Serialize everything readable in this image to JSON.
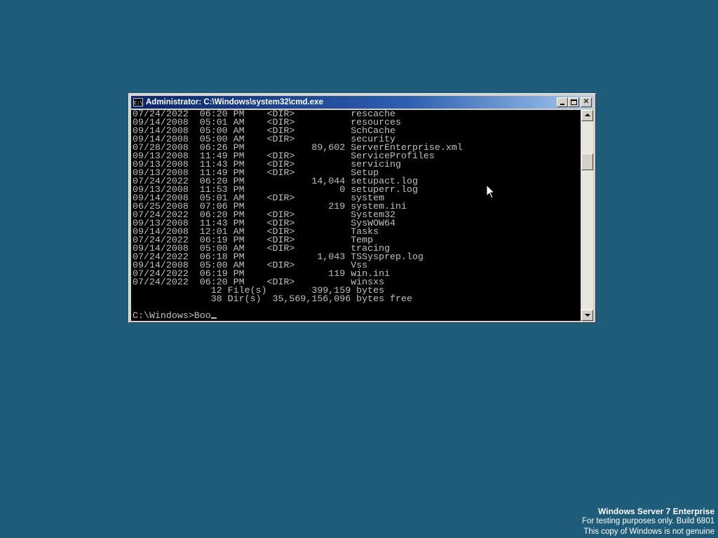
{
  "window": {
    "title": "Administrator: C:\\Windows\\system32\\cmd.exe",
    "icon_label": "C:\\",
    "close_label": "✕"
  },
  "console": {
    "lines": [
      "07/24/2022  06:20 PM    <DIR>          rescache",
      "09/14/2008  05:01 AM    <DIR>          resources",
      "09/14/2008  05:00 AM    <DIR>          SchCache",
      "09/14/2008  05:00 AM    <DIR>          security",
      "07/28/2008  06:26 PM            89,602 ServerEnterprise.xml",
      "09/13/2008  11:49 PM    <DIR>          ServiceProfiles",
      "09/13/2008  11:43 PM    <DIR>          servicing",
      "09/13/2008  11:49 PM    <DIR>          Setup",
      "07/24/2022  06:20 PM            14,044 setupact.log",
      "09/13/2008  11:53 PM                 0 setuperr.log",
      "09/14/2008  05:01 AM    <DIR>          system",
      "06/25/2008  07:06 PM               219 system.ini",
      "07/24/2022  06:20 PM    <DIR>          System32",
      "09/13/2008  11:43 PM    <DIR>          SysWOW64",
      "09/14/2008  12:01 AM    <DIR>          Tasks",
      "07/24/2022  06:19 PM    <DIR>          Temp",
      "09/14/2008  05:00 AM    <DIR>          tracing",
      "07/24/2022  06:18 PM             1,043 TSSysprep.log",
      "09/14/2008  05:00 AM    <DIR>          Vss",
      "07/24/2022  06:19 PM               119 win.ini",
      "07/24/2022  06:20 PM    <DIR>          winsxs",
      "              12 File(s)        399,159 bytes",
      "              38 Dir(s)  35,569,156,096 bytes free"
    ],
    "prompt": "C:\\Windows>Boo"
  },
  "watermark": {
    "title": "Windows Server 7 Enterprise",
    "line2": "For testing purposes only. Build 6801",
    "line3": "This copy of Windows is not genuine"
  },
  "colors": {
    "desktop": "#1f5c7a",
    "console_bg": "#000000",
    "console_fg": "#c0c0c0",
    "titlebar_start": "#0a246a",
    "titlebar_end": "#a6caf0"
  }
}
